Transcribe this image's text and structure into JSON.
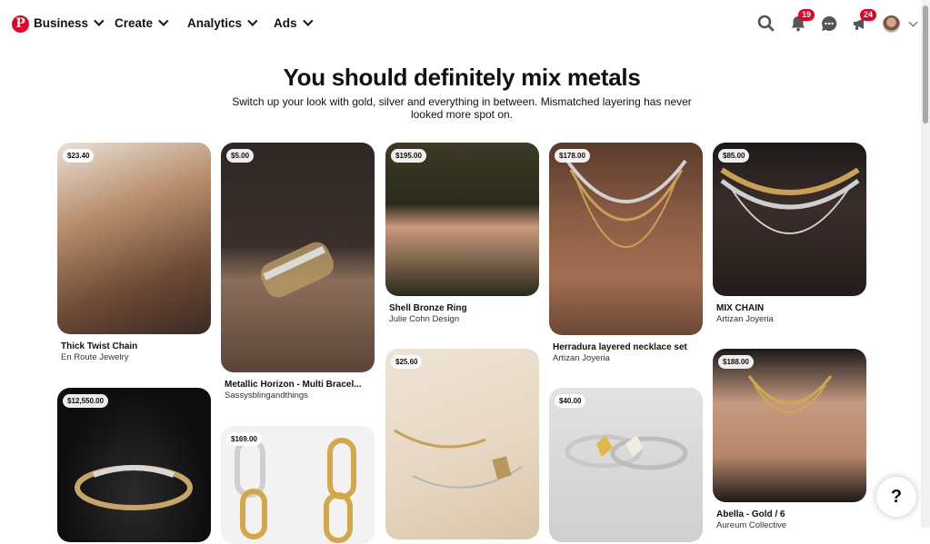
{
  "nav": {
    "logo_letter": "P",
    "menus": [
      "Business",
      "Create",
      "Analytics",
      "Ads"
    ],
    "notifications_count": "19",
    "updates_count": "24"
  },
  "header": {
    "title": "You should definitely mix metals",
    "subtitle": "Switch up your look with gold, silver and everything in between. Mismatched layering has never looked more spot on."
  },
  "pins": [
    {
      "price": "$23.40",
      "title": "Thick Twist Chain",
      "source": "En Route Jewelry"
    },
    {
      "price": "$12,550.00",
      "title": "",
      "source": ""
    },
    {
      "price": "$5.00",
      "title": "Metallic Horizon - Multi Bracel...",
      "source": "Sassysblingandthings"
    },
    {
      "price": "$169.00",
      "title": "",
      "source": ""
    },
    {
      "price": "$195.00",
      "title": "Shell Bronze Ring",
      "source": "Julie Cohn Design"
    },
    {
      "price": "$25.60",
      "title": "",
      "source": ""
    },
    {
      "price": "$178.00",
      "title": "Herradura layered necklace set",
      "source": "Artizan Joyeria"
    },
    {
      "price": "$40.00",
      "title": "",
      "source": ""
    },
    {
      "price": "$85.00",
      "title": "MIX CHAIN",
      "source": "Artizan Joyeria"
    },
    {
      "price": "$188.00",
      "title": "Abella - Gold / 6",
      "source": "Aureum Collective"
    }
  ],
  "help_label": "?"
}
